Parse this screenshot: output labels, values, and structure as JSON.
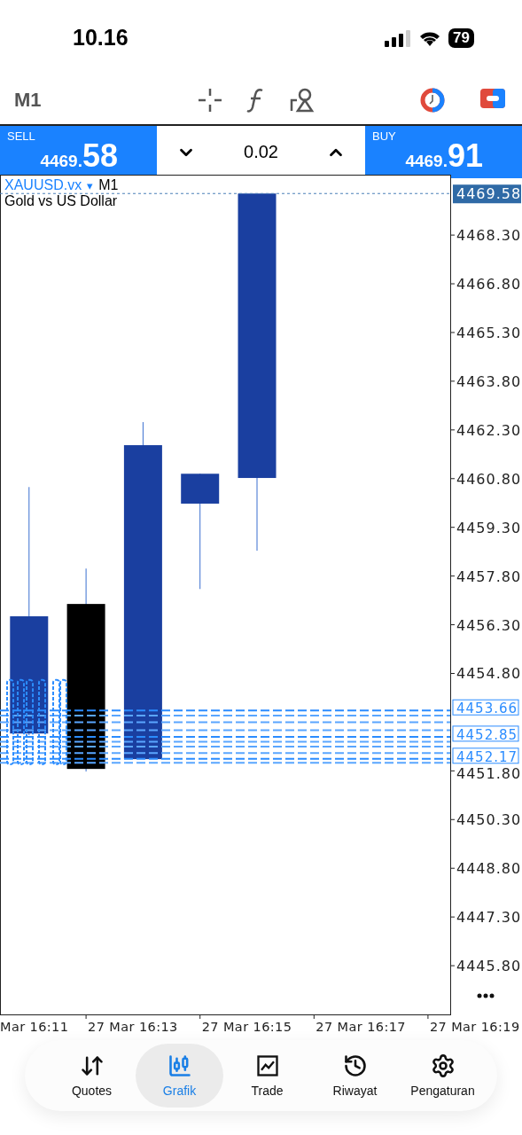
{
  "status_bar": {
    "time": "10.16",
    "battery": "79"
  },
  "toolbar": {
    "timeframe": "M1"
  },
  "trade_bar": {
    "sell": {
      "label": "SELL",
      "price_small": "4469.",
      "price_big": "58"
    },
    "volume": "0.02",
    "buy": {
      "label": "BUY",
      "price_small": "4469.",
      "price_big": "91"
    }
  },
  "chart": {
    "symbol": "XAUUSD.vx",
    "caret": "▾",
    "timeframe": "M1",
    "description": "Gold vs US Dollar",
    "current_price": "4469.58",
    "order_labels": [
      "4453.66",
      "4452.85",
      "4452.17"
    ],
    "y_axis_labels": [
      "4468.30",
      "4466.80",
      "4465.30",
      "4463.80",
      "4462.30",
      "4460.80",
      "4459.30",
      "4457.80",
      "4456.30",
      "4454.80",
      "4451.80",
      "4450.30",
      "4448.80",
      "4447.30",
      "4445.80"
    ],
    "x_axis_labels": [
      "Mar 16:11",
      "27 Mar 16:13",
      "27 Mar 16:15",
      "27 Mar 16:17",
      "27 Mar 16:19"
    ]
  },
  "nav": [
    {
      "label": "Quotes",
      "selected": false
    },
    {
      "label": "Grafik",
      "selected": true
    },
    {
      "label": "Trade",
      "selected": false
    },
    {
      "label": "Riwayat",
      "selected": false
    },
    {
      "label": "Pengaturan",
      "selected": false
    }
  ]
}
